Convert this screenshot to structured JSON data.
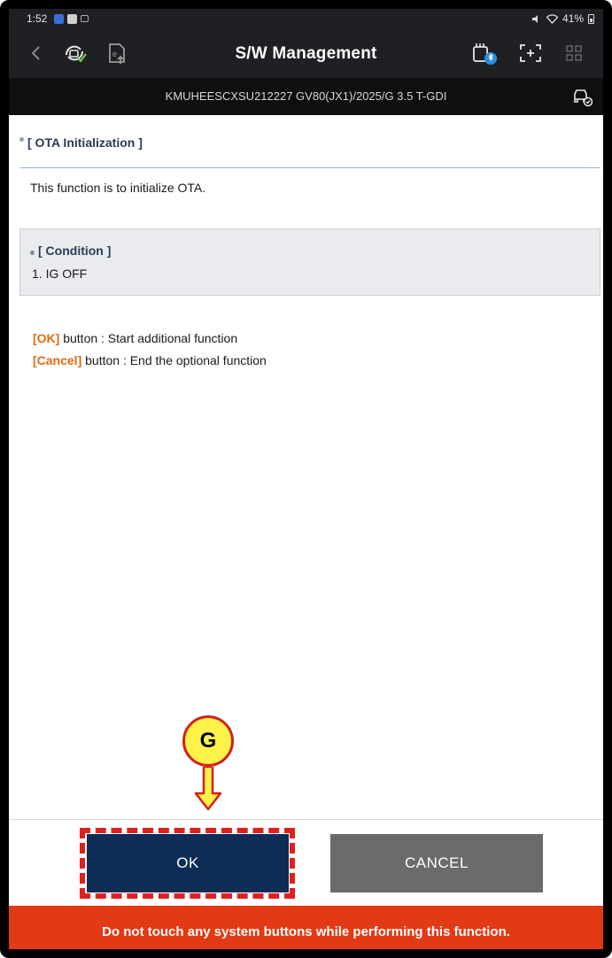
{
  "status_bar": {
    "time": "1:52",
    "battery": "41%"
  },
  "header": {
    "title": "S/W Management",
    "icons": [
      "back-icon",
      "ota-check-icon",
      "export-icon",
      "bluetooth-vci-icon",
      "screen-capture-icon",
      "grid-menu-icon"
    ]
  },
  "vehicle": {
    "info": "KMUHEESCXSU212227  GV80(JX1)/2025/G 3.5 T-GDI",
    "icon": "vehicle-status-icon"
  },
  "content": {
    "section_title": "[ OTA Initialization ]",
    "description": "This function is to initialize OTA.",
    "condition": {
      "title": "[ Condition ]",
      "items": [
        "1. IG OFF"
      ]
    },
    "notes": [
      {
        "key": "[OK]",
        "text": " button : Start additional function"
      },
      {
        "key": "[Cancel]",
        "text": " button : End the optional function"
      }
    ]
  },
  "buttons": {
    "ok": "OK",
    "cancel": "CANCEL"
  },
  "warning": "Do not touch any system buttons while performing this function.",
  "annotation": {
    "marker": "G"
  },
  "colors": {
    "header_bg": "#1f2023",
    "ok_button": "#0d2d57",
    "cancel_button": "#6b6b6b",
    "warning_bg": "#e23a14",
    "highlight_text": "#e36a12",
    "annotation_outline": "#e0201e",
    "marker_fill": "#fdf24a"
  }
}
